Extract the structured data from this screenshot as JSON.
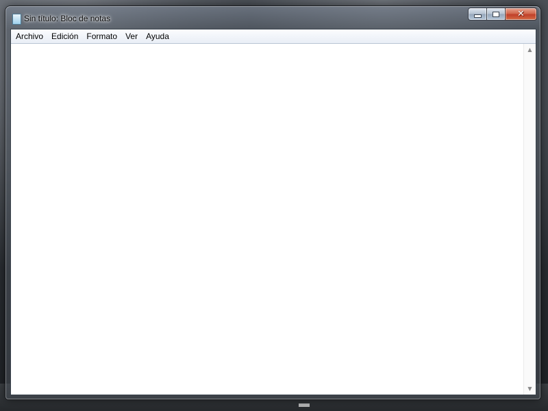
{
  "window": {
    "title": "Sin título: Bloc de notas",
    "app_icon": "notepad-icon"
  },
  "caption_buttons": {
    "minimize_icon": "minimize-icon",
    "maximize_icon": "maximize-icon",
    "close_icon": "close-icon",
    "close_glyph": "✕"
  },
  "menubar": {
    "items": [
      {
        "label": "Archivo"
      },
      {
        "label": "Edición"
      },
      {
        "label": "Formato"
      },
      {
        "label": "Ver"
      },
      {
        "label": "Ayuda"
      }
    ]
  },
  "editor": {
    "content": ""
  },
  "scrollbar": {
    "up_arrow": "▲",
    "down_arrow": "▼"
  },
  "colors": {
    "close_button": "#c0402a",
    "menubar_bg": "#e9eef6",
    "client_bg": "#ffffff"
  }
}
